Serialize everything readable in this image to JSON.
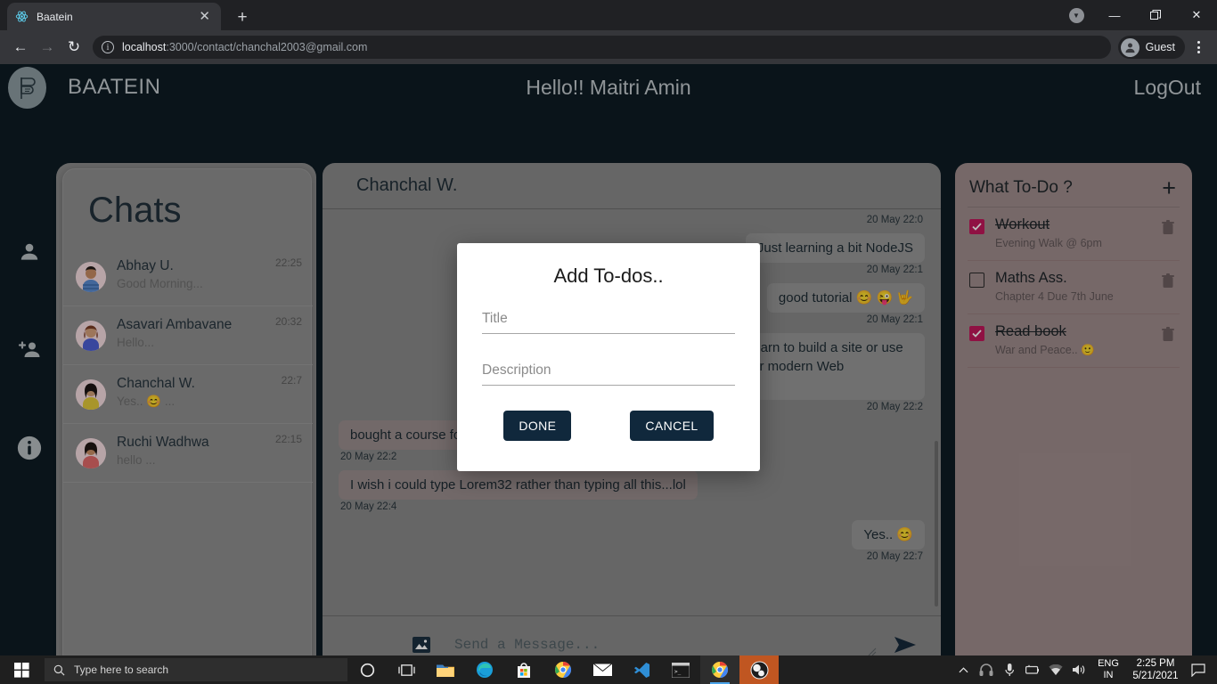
{
  "browser": {
    "tab": {
      "title": "Baatein",
      "favicon_icon": "react-atom-icon",
      "close_icon": "close-icon"
    },
    "newtab_icon": "plus-icon",
    "window_controls": {
      "caret_icon": "caret-down-icon",
      "minimize_icon": "minimize-icon",
      "maximize_icon": "maximize-icon",
      "close_icon": "close-icon"
    },
    "toolbar": {
      "back_icon": "back-arrow-icon",
      "forward_icon": "forward-arrow-icon",
      "reload_icon": "reload-icon",
      "info_icon": "info-circle-icon",
      "url_host": "localhost",
      "url_path": ":3000/contact/chanchal2003@gmail.com",
      "profile_label": "Guest",
      "profile_icon": "account-circle-icon",
      "menu_icon": "kebab-menu-icon"
    }
  },
  "app": {
    "brand": "BAATEIN",
    "greeting": "Hello!! Maitri Amin",
    "logout": "LogOut",
    "logo_icon": "baatein-logo-icon",
    "rail": [
      {
        "icon": "person-icon",
        "name": "profile"
      },
      {
        "icon": "person-add-icon",
        "name": "add-contact"
      },
      {
        "icon": "info-icon",
        "name": "about"
      }
    ]
  },
  "chats": {
    "title": "Chats",
    "items": [
      {
        "name": "Abhay U.",
        "last": "Good Morning...",
        "time": "22:25",
        "shirt": "#5b8bd0",
        "hair": "#221a17"
      },
      {
        "name": "Asavari Ambavane",
        "last": "Hello...",
        "time": "20:32",
        "shirt": "#4e5fd4",
        "hair": "#7a3b24"
      },
      {
        "name": "Chanchal W.",
        "last": "Yes.. 😊 ...",
        "time": "22:7",
        "shirt": "#e3c93a",
        "hair": "#1b1513"
      },
      {
        "name": "Ruchi Wadhwa",
        "last": "hello ...",
        "time": "22:15",
        "shirt": "#e26a6a",
        "hair": "#201613"
      }
    ]
  },
  "conversation": {
    "header_name": "Chanchal W.",
    "messages": [
      {
        "text": "",
        "time": "20 May 22:0",
        "side": "out",
        "empty": true
      },
      {
        "text": "Just learning a bit NodeJS",
        "time": "20 May 22:1",
        "side": "out"
      },
      {
        "text": "good tutorial 😊 😜 🤟",
        "time": "20 May 22:1",
        "side": "out"
      },
      {
        "text": "Whether you are just getting started, learn to build a site or use  tips to improve your used Tech skills for modern Web Technologies",
        "time": "20 May 22:2",
        "side": "out"
      },
      {
        "text": "bought a course for this",
        "time": "20 May 22:2",
        "side": "in"
      },
      {
        "text": "I wish i could type Lorem32 rather than typing all this...lol",
        "time": "20 May 22:4",
        "side": "in"
      },
      {
        "text": "Yes.. 😊",
        "time": "20 May 22:7",
        "side": "out"
      }
    ],
    "composer": {
      "placeholder": "Send a Message...",
      "image_icon": "image-attach-icon",
      "send_icon": "send-arrow-icon",
      "resize_icon": "resize-grip-icon"
    }
  },
  "todo": {
    "title": "What To-Do ?",
    "add_icon": "plus-icon",
    "checked_color": "#c2185b",
    "items": [
      {
        "name": "Workout",
        "desc": "Evening Walk @ 6pm",
        "checked": true,
        "trash_icon": "trash-icon"
      },
      {
        "name": "Maths Ass.",
        "desc": "Chapter 4 Due 7th June",
        "checked": false,
        "trash_icon": "trash-icon"
      },
      {
        "name": "Read book",
        "desc": "War and Peace.. 🙂",
        "checked": true,
        "trash_icon": "trash-icon"
      }
    ]
  },
  "modal": {
    "title": "Add To-dos..",
    "title_placeholder": "Title",
    "title_value": "",
    "desc_placeholder": "Description",
    "desc_value": "",
    "done_label": "DONE",
    "cancel_label": "CANCEL",
    "button_color": "#10283c"
  },
  "taskbar": {
    "start_icon": "windows-start-icon",
    "search_placeholder": "Type here to search",
    "search_icon": "search-icon",
    "icons": [
      {
        "name": "cortana-icon"
      },
      {
        "name": "task-view-icon"
      },
      {
        "name": "file-explorer-icon"
      },
      {
        "name": "edge-icon"
      },
      {
        "name": "microsoft-store-icon"
      },
      {
        "name": "chrome-icon"
      },
      {
        "name": "mail-icon"
      },
      {
        "name": "vscode-icon"
      },
      {
        "name": "terminal-icon"
      },
      {
        "name": "chrome-active-icon"
      },
      {
        "name": "obs-icon"
      }
    ],
    "tray": {
      "chevron_icon": "chevron-up-icon",
      "headphones_icon": "headphones-icon",
      "mic_icon": "microphone-icon",
      "battery_icon": "battery-icon",
      "wifi_icon": "wifi-icon",
      "volume_icon": "volume-icon",
      "lang_line1": "ENG",
      "lang_line2": "IN",
      "time": "2:25 PM",
      "date": "5/21/2021",
      "notification_icon": "notification-icon"
    }
  }
}
